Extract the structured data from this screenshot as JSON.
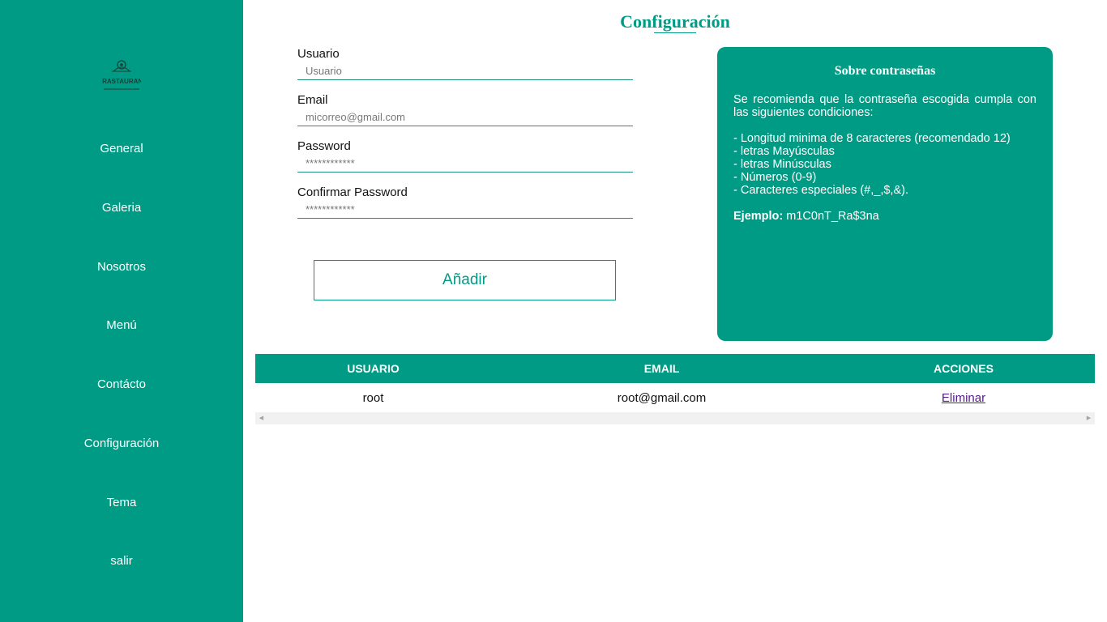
{
  "sidebar": {
    "logo_text": "MURASTAURANTE",
    "items": [
      {
        "label": "General"
      },
      {
        "label": "Galeria"
      },
      {
        "label": "Nosotros"
      },
      {
        "label": "Menú"
      },
      {
        "label": "Contácto"
      },
      {
        "label": "Configuración"
      },
      {
        "label": "Tema"
      },
      {
        "label": "salir"
      }
    ]
  },
  "page": {
    "title": "Configuración"
  },
  "form": {
    "usuario": {
      "label": "Usuario",
      "placeholder": "Usuario"
    },
    "email": {
      "label": "Email",
      "placeholder": "micorreo@gmail.com"
    },
    "password": {
      "label": "Password",
      "placeholder": "************"
    },
    "confirm": {
      "label": "Confirmar Password",
      "placeholder": "************"
    },
    "submit_label": "Añadir"
  },
  "info": {
    "title": "Sobre contraseñas",
    "intro": "Se recomienda que la contraseña escogida cumpla con las siguientes condiciones:",
    "conditions": [
      "- Longitud minima de 8 caracteres (recomendado 12)",
      "- letras Mayúsculas",
      "- letras Minúsculas",
      "- Números (0-9)",
      "- Caracteres especiales (#,_,$,&)."
    ],
    "example_label": "Ejemplo:",
    "example_value": "m1C0nT_Ra$3na"
  },
  "table": {
    "headers": [
      "USUARIO",
      "EMAIL",
      "ACCIONES"
    ],
    "rows": [
      {
        "usuario": "root",
        "email": "root@gmail.com",
        "action": "Eliminar"
      }
    ]
  },
  "colors": {
    "accent": "#009b84",
    "white": "#ffffff"
  },
  "icons": {
    "scroll_left": "triangle-left-icon",
    "scroll_right": "triangle-right-icon",
    "logo": "restaurant-logo-icon"
  }
}
